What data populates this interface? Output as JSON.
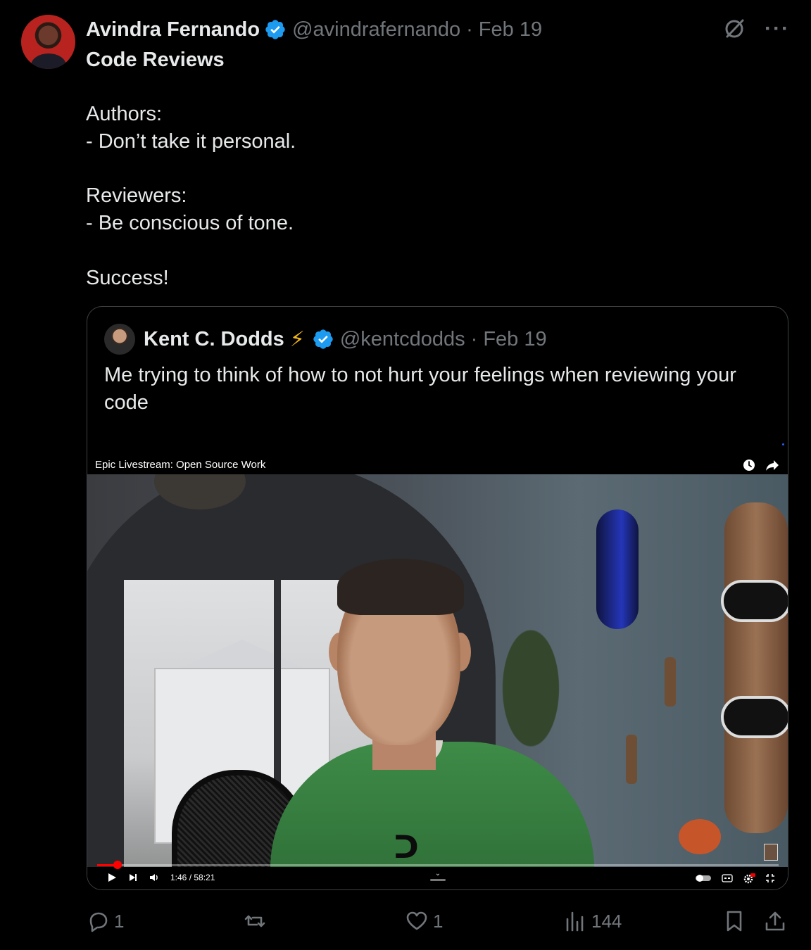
{
  "tweet": {
    "author_name": "Avindra Fernando",
    "handle": "@avindrafernando",
    "separator": "·",
    "date": "Feb 19",
    "more_label": "···",
    "lines": [
      "Code Reviews",
      "",
      "Authors:",
      "- Don’t take it personal.",
      "",
      "Reviewers:",
      "- Be conscious of tone.",
      "",
      "Success!"
    ]
  },
  "quote": {
    "author_name": "Kent C. Dodds",
    "emoji": "⚡",
    "handle": "@kentcdodds",
    "separator": "·",
    "date": "Feb 19",
    "text": "Me trying to think of how to not hurt your feelings when reviewing your code"
  },
  "video": {
    "title": "Epic Livestream: Open Source Work",
    "time": "1:46 / 58:21",
    "progress_fraction": 0.03,
    "shirt_logo": "ᑐ"
  },
  "actions": {
    "replies": "1",
    "reposts": "",
    "likes": "1",
    "views": "144"
  },
  "colors": {
    "background": "#000000",
    "text": "#e7e9ea",
    "muted": "#71767b",
    "verified": "#1d9bf0",
    "progress": "#ff0000"
  }
}
